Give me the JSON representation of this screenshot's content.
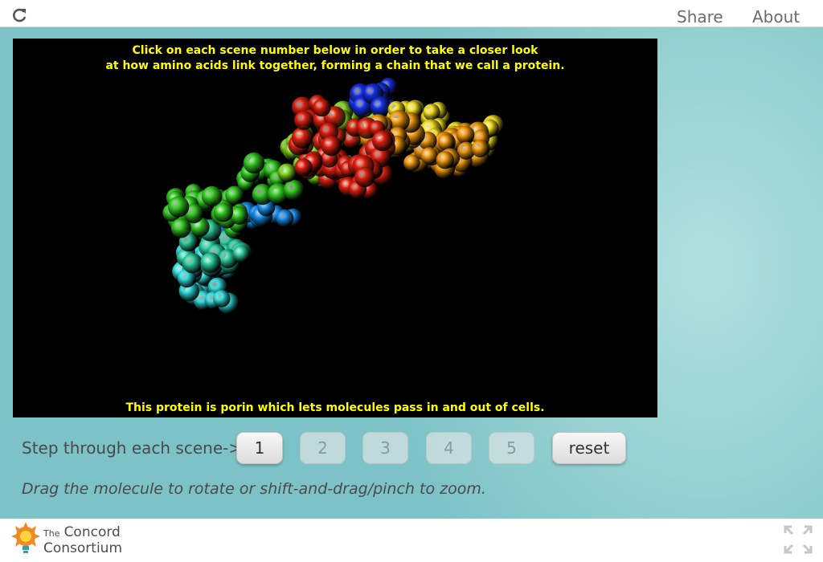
{
  "header": {
    "share_label": "Share",
    "about_label": "About"
  },
  "viewer": {
    "instruction_line1": "Click on each scene number below in order to take a closer look",
    "instruction_line2": "at how amino acids link together, forming a chain that we call a protein.",
    "caption": "This protein is porin which lets molecules pass in and out of cells."
  },
  "controls": {
    "step_label": "Step through each scene->",
    "scene_buttons": [
      "1",
      "2",
      "3",
      "4",
      "5"
    ],
    "reset_label": "reset",
    "hint": "Drag the molecule to rotate or shift-and-drag/pinch to zoom."
  },
  "footer": {
    "logo_the": "The",
    "logo_concord": "Concord",
    "logo_consortium": "Consortium"
  },
  "colors": {
    "viewer_text": "#ffff00",
    "background_teal": "#7cc2c6",
    "logo_orange": "#f08a24"
  }
}
